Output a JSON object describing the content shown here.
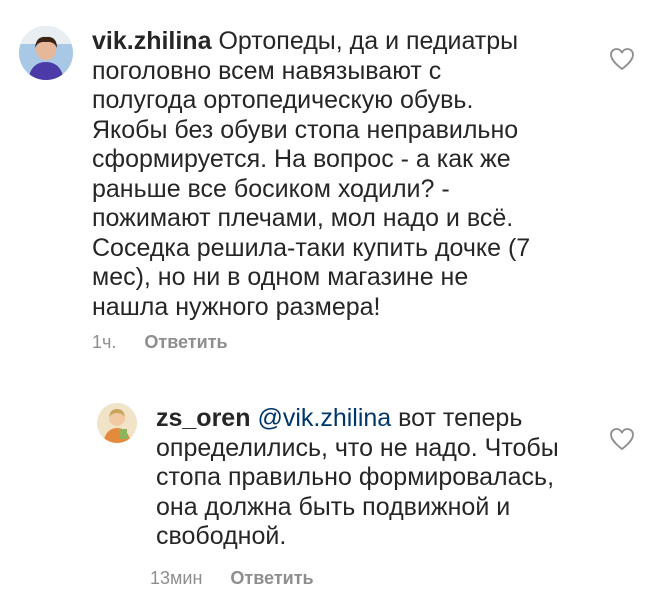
{
  "comments": [
    {
      "username": "vik.zhilina",
      "avatar_icon": "user-avatar-woman",
      "lines": [
        "Ортопеды, да и педиатры",
        "поголовно всем навязывают с",
        "полугода ортопедическую обувь.",
        "Якобы без обуви стопа неправильно",
        "сформируется. На вопрос - а как же",
        "раньше все босиком ходили? -",
        "пожимают плечами, мол надо и всё.",
        "Соседка решила-таки купить дочке (7",
        "мес), но ни в одном магазине не",
        "нашла нужного размера!"
      ],
      "time": "1ч.",
      "reply_label": "Ответить",
      "like_icon": "heart-outline-icon"
    },
    {
      "username": "zs_oren",
      "avatar_icon": "user-avatar-child",
      "mention": "@vik.zhilina",
      "lines": [
        "вот теперь",
        "определились, что не надо. Чтобы",
        "стопа правильно формировалась,",
        "она должна быть подвижной и",
        "свободной."
      ],
      "time": "13мин",
      "reply_label": "Ответить",
      "like_icon": "heart-outline-icon"
    }
  ],
  "colors": {
    "text": "#262626",
    "secondary": "#8e8e8e",
    "mention": "#00376b",
    "background": "#ffffff"
  }
}
